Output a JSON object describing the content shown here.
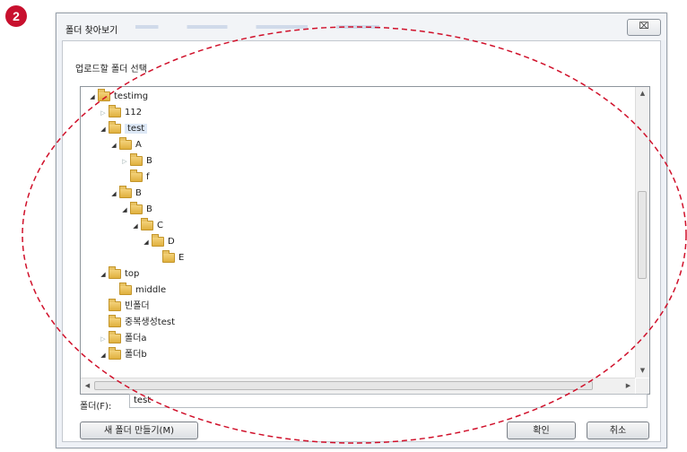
{
  "badge": "2",
  "window": {
    "title": "폴더 찾아보기",
    "close_label": "⌧",
    "description": "업로드할 폴더 선택"
  },
  "tree": {
    "items": [
      {
        "label": "testimg",
        "indent": 0,
        "expander": "expanded",
        "selected": false
      },
      {
        "label": "112",
        "indent": 1,
        "expander": "collapsed",
        "selected": false
      },
      {
        "label": "test",
        "indent": 1,
        "expander": "expanded",
        "selected": true
      },
      {
        "label": "A",
        "indent": 2,
        "expander": "expanded",
        "selected": false
      },
      {
        "label": "B",
        "indent": 3,
        "expander": "collapsed",
        "selected": false
      },
      {
        "label": "f",
        "indent": 3,
        "expander": "none",
        "selected": false
      },
      {
        "label": "B",
        "indent": 2,
        "expander": "expanded",
        "selected": false
      },
      {
        "label": "B",
        "indent": 3,
        "expander": "expanded",
        "selected": false
      },
      {
        "label": "C",
        "indent": 4,
        "expander": "expanded",
        "selected": false
      },
      {
        "label": "D",
        "indent": 5,
        "expander": "expanded",
        "selected": false
      },
      {
        "label": "E",
        "indent": 6,
        "expander": "none",
        "selected": false
      },
      {
        "label": "top",
        "indent": 1,
        "expander": "expanded",
        "selected": false
      },
      {
        "label": "middle",
        "indent": 2,
        "expander": "none",
        "selected": false
      },
      {
        "label": "빈폴더",
        "indent": 1,
        "expander": "none",
        "selected": false
      },
      {
        "label": "중복생성test",
        "indent": 1,
        "expander": "none",
        "selected": false
      },
      {
        "label": "폴더a",
        "indent": 1,
        "expander": "collapsed",
        "selected": false
      },
      {
        "label": "폴더b",
        "indent": 1,
        "expander": "expanded",
        "selected": false
      }
    ]
  },
  "folder_field": {
    "label": "폴더(F):",
    "value": "test"
  },
  "buttons": {
    "new_folder": "새 폴더 만들기(M)",
    "ok": "확인",
    "cancel": "취소"
  },
  "colors": {
    "badge": "#c8102e",
    "annotation": "#d0102a",
    "selection": "#dde8f6"
  }
}
